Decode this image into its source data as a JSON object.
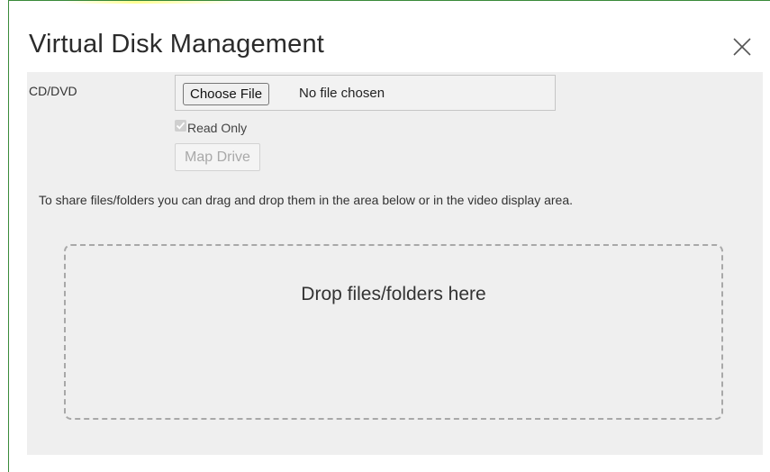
{
  "dialog": {
    "title": "Virtual Disk Management",
    "close_icon": "close-icon"
  },
  "cd_dvd": {
    "label": "CD/DVD",
    "choose_file_label": "Choose File",
    "file_status": "No file chosen",
    "read_only_label": "Read Only",
    "read_only_checked": true,
    "read_only_disabled": true,
    "map_drive_label": "Map Drive",
    "map_drive_disabled": true
  },
  "share": {
    "instructions": "To share files/folders you can drag and drop them in the area below or in the video display area.",
    "drop_label": "Drop files/folders here"
  },
  "colors": {
    "content_background": "#efefef",
    "frame_border": "#3a8a3a",
    "dropzone_border": "#a8a8a8"
  }
}
